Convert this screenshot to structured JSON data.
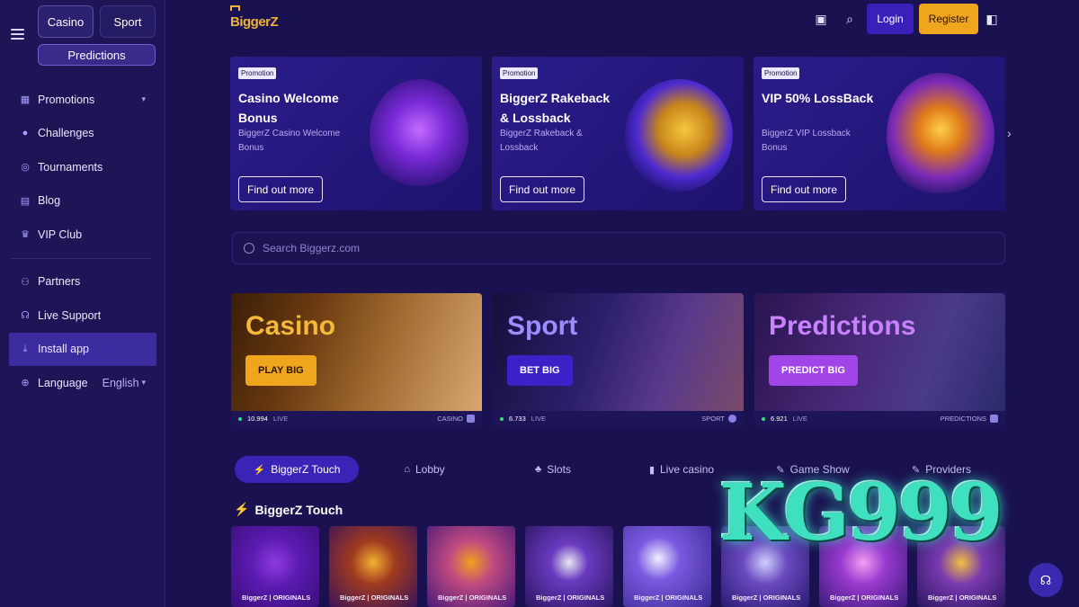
{
  "sidebar": {
    "modes": [
      "Casino",
      "Sport",
      "Predictions"
    ],
    "items": [
      {
        "label": "Promotions",
        "icon": "gift-icon",
        "has_chevron": true
      },
      {
        "label": "Challenges",
        "icon": "person-icon"
      },
      {
        "label": "Tournaments",
        "icon": "medal-icon"
      },
      {
        "label": "Blog",
        "icon": "document-icon"
      },
      {
        "label": "VIP Club",
        "icon": "trophy-icon"
      },
      {
        "label": "Partners",
        "icon": "people-icon"
      },
      {
        "label": "Live Support",
        "icon": "headset-icon"
      },
      {
        "label": "Install app",
        "icon": "download-icon",
        "active": true
      },
      {
        "label": "Language",
        "icon": "globe-icon",
        "value": "English"
      }
    ]
  },
  "header": {
    "logo": "BiggerZ",
    "login": "Login",
    "register": "Register"
  },
  "promotions": [
    {
      "badge": "Promotion",
      "title": "Casino Welcome Bonus",
      "subtitle": "BiggerZ Casino Welcome Bonus",
      "button": "Find out more"
    },
    {
      "badge": "Promotion",
      "title": "BiggerZ Rakeback & Lossback",
      "subtitle": "BiggerZ Rakeback & Lossback",
      "button": "Find out more"
    },
    {
      "badge": "Promotion",
      "title": "VIP 50% LossBack",
      "subtitle": "BiggerZ VIP Lossback Bonus",
      "button": "Find out more"
    }
  ],
  "search": {
    "placeholder": "Search Biggerz.com"
  },
  "categories": [
    {
      "title": "Casino",
      "button": "PLAY BIG",
      "count": "10.994",
      "live": "LIVE",
      "tag": "CASINO"
    },
    {
      "title": "Sport",
      "button": "BET BIG",
      "count": "6.733",
      "live": "LIVE",
      "tag": "SPORT"
    },
    {
      "title": "Predictions",
      "button": "PREDICT BIG",
      "count": "6.921",
      "live": "LIVE",
      "tag": "PREDICTIONS"
    }
  ],
  "game_tabs": [
    {
      "label": "BiggerZ Touch",
      "icon": "⚡",
      "active": true
    },
    {
      "label": "Lobby",
      "icon": "⌂"
    },
    {
      "label": "Slots",
      "icon": "♣"
    },
    {
      "label": "Live casino",
      "icon": "▮"
    },
    {
      "label": "Game Show",
      "icon": "✎"
    },
    {
      "label": "Providers",
      "icon": "✎"
    }
  ],
  "section": {
    "title": "BiggerZ Touch"
  },
  "games": [
    {
      "label": "BiggerZ | ORIGINALS"
    },
    {
      "label": "BiggerZ | ORIGINALS"
    },
    {
      "label": "BiggerZ | ORIGINALS"
    },
    {
      "label": "BiggerZ | ORIGINALS"
    },
    {
      "label": "BiggerZ | ORIGINALS"
    },
    {
      "label": "BiggerZ | ORIGINALS"
    },
    {
      "label": "BiggerZ | ORIGINALS"
    },
    {
      "label": "BiggerZ | ORIGINALS"
    }
  ],
  "watermark": "KG999"
}
